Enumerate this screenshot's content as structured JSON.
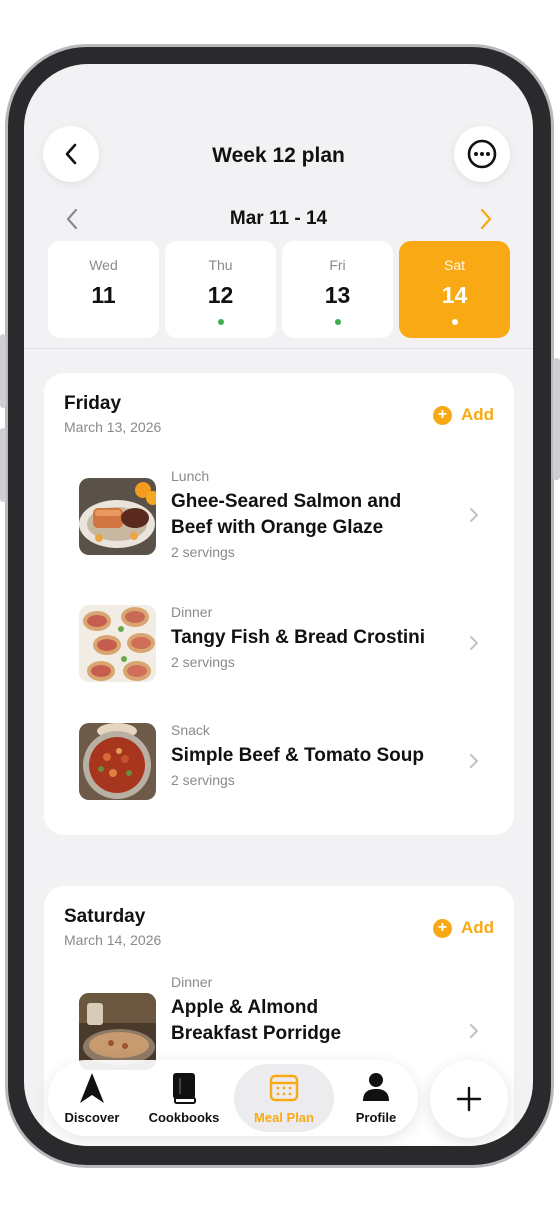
{
  "header": {
    "title": "Week 12 plan"
  },
  "week_nav": {
    "range_label": "Mar 11 - 14"
  },
  "days": [
    {
      "name": "Wed",
      "num": "11",
      "active": false,
      "dot": false
    },
    {
      "name": "Thu",
      "num": "12",
      "active": false,
      "dot": true
    },
    {
      "name": "Fri",
      "num": "13",
      "active": false,
      "dot": true
    },
    {
      "name": "Sat",
      "num": "14",
      "active": true,
      "dot": true
    }
  ],
  "sections": [
    {
      "title": "Friday",
      "date": "March 13, 2026",
      "add_label": "Add",
      "meals": [
        {
          "type": "Lunch",
          "name": "Ghee-Seared Salmon and Beef with Orange Glaze",
          "servings": "2 servings",
          "thumb": "salmon-dish"
        },
        {
          "type": "Dinner",
          "name": "Tangy Fish & Bread Crostini",
          "servings": "2 servings",
          "thumb": "crostini-dish"
        },
        {
          "type": "Snack",
          "name": "Simple Beef & Tomato Soup",
          "servings": "2 servings",
          "thumb": "soup-dish"
        }
      ]
    },
    {
      "title": "Saturday",
      "date": "March 14, 2026",
      "add_label": "Add",
      "meals": [
        {
          "type": "Dinner",
          "name": "Apple & Almond Breakfast Porridge",
          "servings": "",
          "thumb": "porridge-dish"
        }
      ]
    }
  ],
  "tabbar": {
    "items": [
      {
        "label": "Discover",
        "icon": "navigation-arrow-icon",
        "active": false
      },
      {
        "label": "Cookbooks",
        "icon": "book-icon",
        "active": false
      },
      {
        "label": "Meal Plan",
        "icon": "calendar-icon",
        "active": true
      },
      {
        "label": "Profile",
        "icon": "person-icon",
        "active": false
      }
    ],
    "fab_icon": "plus-icon"
  },
  "colors": {
    "accent": "#f9a913",
    "background": "#f2f2f4",
    "card": "#ffffff",
    "muted_text": "#8a8a8e"
  }
}
